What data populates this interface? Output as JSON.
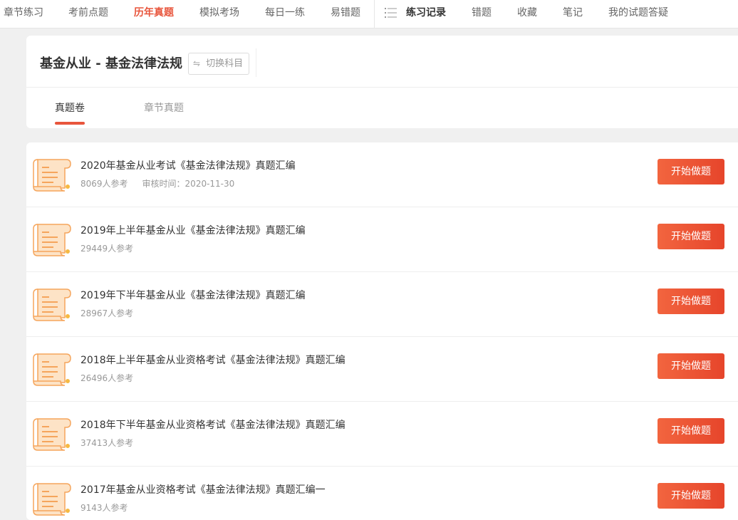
{
  "nav": {
    "items": [
      {
        "label": "章节练习",
        "active": false
      },
      {
        "label": "考前点题",
        "active": false
      },
      {
        "label": "历年真题",
        "active": true
      },
      {
        "label": "模拟考场",
        "active": false
      },
      {
        "label": "每日一练",
        "active": false
      },
      {
        "label": "易错题",
        "active": false
      }
    ],
    "right_items": [
      {
        "label": "练习记录",
        "bold": true
      },
      {
        "label": "错题"
      },
      {
        "label": "收藏"
      },
      {
        "label": "笔记"
      },
      {
        "label": "我的试题答疑"
      }
    ],
    "list_icon": "list-icon"
  },
  "header": {
    "title": "基金从业 - 基金法律法规",
    "switch_icon": "⇋",
    "switch_label": "切换科目",
    "tabs": [
      {
        "label": "真题卷",
        "active": true
      },
      {
        "label": "章节真题",
        "active": false
      }
    ]
  },
  "papers": [
    {
      "title": "2020年基金从业考试《基金法律法规》真题汇编",
      "participants": "8069人参考",
      "review": "审核时间：2020-11-30"
    },
    {
      "title": "2019年上半年基金从业《基金法律法规》真题汇编",
      "participants": "29449人参考",
      "review": ""
    },
    {
      "title": "2019年下半年基金从业《基金法律法规》真题汇编",
      "participants": "28967人参考",
      "review": ""
    },
    {
      "title": "2018年上半年基金从业资格考试《基金法律法规》真题汇编",
      "participants": "26496人参考",
      "review": ""
    },
    {
      "title": "2018年下半年基金从业资格考试《基金法律法规》真题汇编",
      "participants": "37413人参考",
      "review": ""
    },
    {
      "title": "2017年基金从业资格考试《基金法律法规》真题汇编一",
      "participants": "9143人参考",
      "review": ""
    }
  ],
  "start_label": "开始做题",
  "colors": {
    "accent": "#e8553c",
    "icon_orange": "#f5a55c"
  }
}
